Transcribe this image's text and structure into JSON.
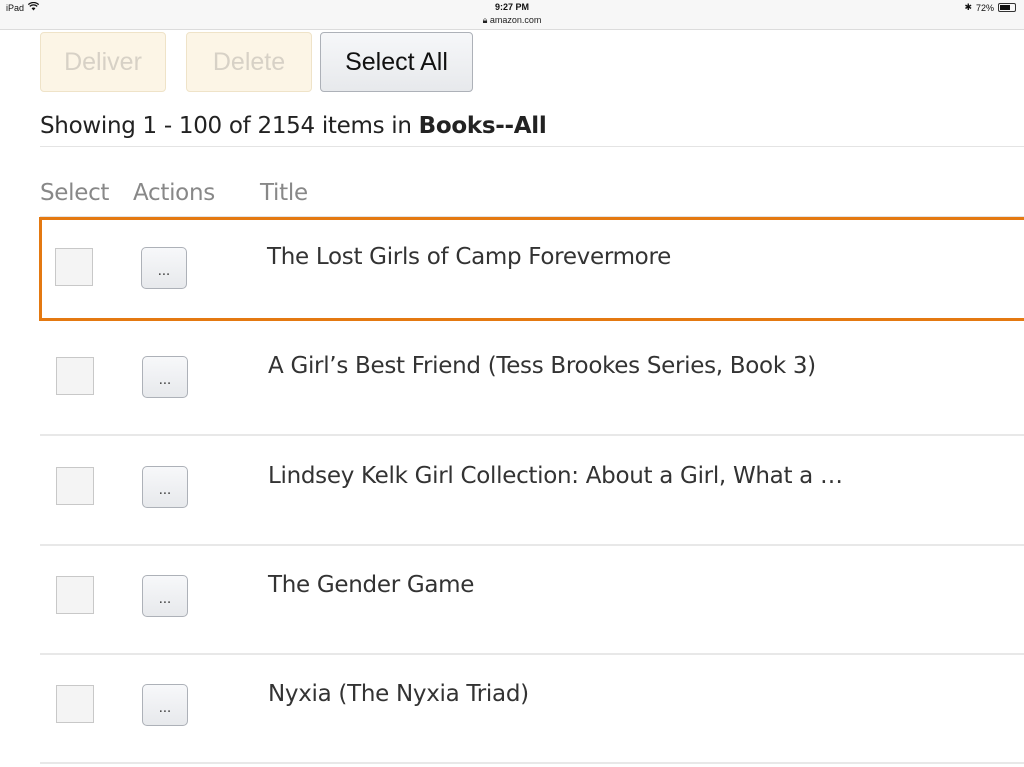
{
  "status_bar": {
    "device": "iPad",
    "time": "9:27 PM",
    "url": "amazon.com",
    "battery_percent": "72%",
    "battery_level": 0.72
  },
  "toolbar": {
    "deliver_label": "Deliver",
    "delete_label": "Delete",
    "select_all_label": "Select All"
  },
  "summary": {
    "prefix": "Showing 1 - 100 of 2154 items in ",
    "category": "Books--All"
  },
  "columns": {
    "select": "Select",
    "actions": "Actions",
    "title": "Title"
  },
  "actions_button_label": "...",
  "items": [
    {
      "title": "The Lost Girls of Camp Forevermore",
      "selected": true
    },
    {
      "title": "A Girl’s Best Friend (Tess Brookes Series, Book 3)",
      "selected": false
    },
    {
      "title": "Lindsey Kelk Girl Collection: About a Girl, What a …",
      "selected": false
    },
    {
      "title": "The Gender Game",
      "selected": false
    },
    {
      "title": "Nyxia (The Nyxia Triad)",
      "selected": false
    }
  ],
  "colors": {
    "highlight": "#e47911"
  }
}
